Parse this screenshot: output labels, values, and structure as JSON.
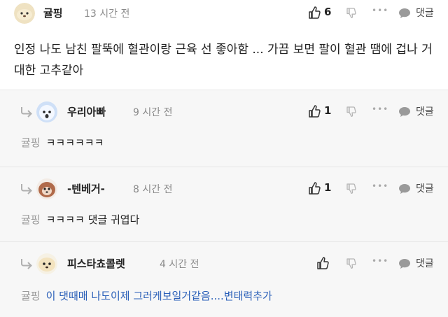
{
  "comments": [
    {
      "nick": "귤핑",
      "time": "13 시간 전",
      "likes": "6",
      "body": "인정 나도 남친 팔뚝에 혈관이랑 근육 선 좋아함 ... 가끔 보면 팔이 혈관 땜에 겁나 거대한 고추같아"
    },
    {
      "nick": "우리아빠",
      "time": "9 시간 전",
      "likes": "1",
      "mention": "귤핑",
      "body": "ㅋㅋㅋㅋㅋㅋ"
    },
    {
      "nick": "-텐베거-",
      "time": "8 시간 전",
      "likes": "1",
      "mention": "귤핑",
      "body": "ㅋㅋㅋㅋ 댓글 귀엽다"
    },
    {
      "nick": "피스타쵸콜렛",
      "time": "4 시간 전",
      "likes": "",
      "mention": "귤핑",
      "body": "이 댓때매 나도이제 그러케보일거같음....변태력추가"
    }
  ],
  "ui": {
    "more": "•••",
    "reply_label": "댓글"
  },
  "colors": {
    "reply_bg": "#f7f7f7",
    "time": "#8a8a8a",
    "highlight_text": "#2a5fb8"
  },
  "icons": [
    "thumbs-up-icon",
    "thumbs-down-icon",
    "more-icon",
    "speech-bubble-icon",
    "reply-arrow-icon"
  ]
}
